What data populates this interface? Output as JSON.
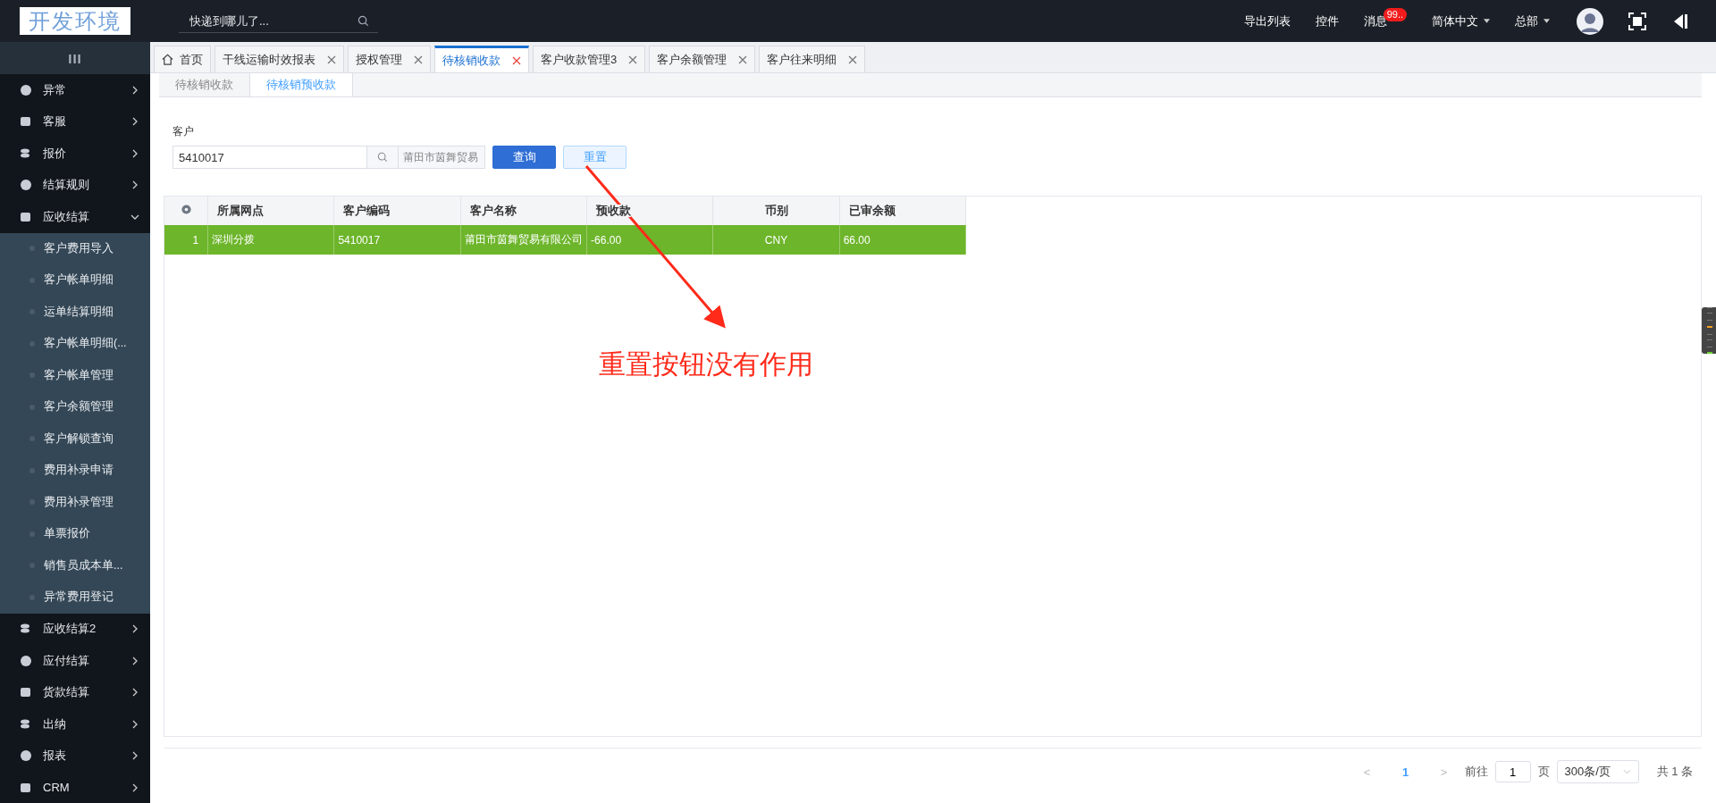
{
  "header": {
    "logo": "开发环境",
    "search": {
      "placeholder": "快递到哪儿了..."
    },
    "links": [
      {
        "label": "导出列表",
        "kind": "link"
      },
      {
        "label": "控件",
        "kind": "link"
      },
      {
        "label": "消息",
        "kind": "badge",
        "badge": "99.."
      },
      {
        "label": "简体中文",
        "kind": "dropdown"
      },
      {
        "label": "总部",
        "kind": "dropdown"
      }
    ]
  },
  "sidebar": {
    "toggle": "III",
    "items": [
      {
        "label": "异常",
        "expanded": false
      },
      {
        "label": "客服",
        "expanded": false
      },
      {
        "label": "报价",
        "expanded": false
      },
      {
        "label": "结算规则",
        "expanded": false
      },
      {
        "label": "应收结算",
        "expanded": true,
        "children": [
          {
            "label": "客户费用导入"
          },
          {
            "label": "客户帐单明细"
          },
          {
            "label": "运单结算明细"
          },
          {
            "label": "客户帐单明细(..."
          },
          {
            "label": "客户帐单管理"
          },
          {
            "label": "客户余额管理"
          },
          {
            "label": "客户解锁查询"
          },
          {
            "label": "费用补录申请"
          },
          {
            "label": "费用补录管理"
          },
          {
            "label": "单票报价"
          },
          {
            "label": "销售员成本单..."
          },
          {
            "label": "异常费用登记"
          }
        ]
      },
      {
        "label": "应收结算2",
        "expanded": false
      },
      {
        "label": "应付结算",
        "expanded": false
      },
      {
        "label": "货款结算",
        "expanded": false
      },
      {
        "label": "出纳",
        "expanded": false
      },
      {
        "label": "报表",
        "expanded": false
      },
      {
        "label": "CRM",
        "expanded": false
      }
    ]
  },
  "tabs": [
    {
      "label": "首页",
      "kind": "home",
      "selected": false
    },
    {
      "label": "干线运输时效报表",
      "kind": "closable",
      "selected": false
    },
    {
      "label": "授权管理",
      "kind": "closable",
      "selected": false
    },
    {
      "label": "待核销收款",
      "kind": "closable",
      "selected": true
    },
    {
      "label": "客户收款管理3",
      "kind": "closable",
      "selected": false
    },
    {
      "label": "客户余额管理",
      "kind": "closable",
      "selected": false
    },
    {
      "label": "客户往来明细",
      "kind": "closable",
      "selected": false
    }
  ],
  "subtabs": [
    {
      "label": "待核销收款",
      "selected": false
    },
    {
      "label": "待核销预收款",
      "selected": true
    }
  ],
  "filter": {
    "label": "客户",
    "code": "5410017",
    "name": "莆田市茵舞贸易",
    "buttons": [
      {
        "label": "查询",
        "kind": "primary"
      },
      {
        "label": "重置",
        "kind": "plain"
      }
    ]
  },
  "table": {
    "columns": [
      "所属网点",
      "客户编码",
      "客户名称",
      "预收款",
      "币别",
      "已审余额"
    ],
    "rows": [
      {
        "index": "1",
        "selected": true,
        "cells": [
          "深圳分拨",
          "5410017",
          "莆田市茵舞贸易有限公司",
          "-66.00",
          "CNY",
          "66.00"
        ]
      }
    ]
  },
  "pagination": {
    "prev": "<",
    "pages": [
      {
        "label": "1",
        "selected": true
      }
    ],
    "next": ">",
    "goto_label": "前往",
    "goto_value": "1",
    "page_unit": "页",
    "page_size": "300条/页",
    "total": "共 1 条"
  },
  "annotation": {
    "text": "重置按钮没有作用"
  }
}
